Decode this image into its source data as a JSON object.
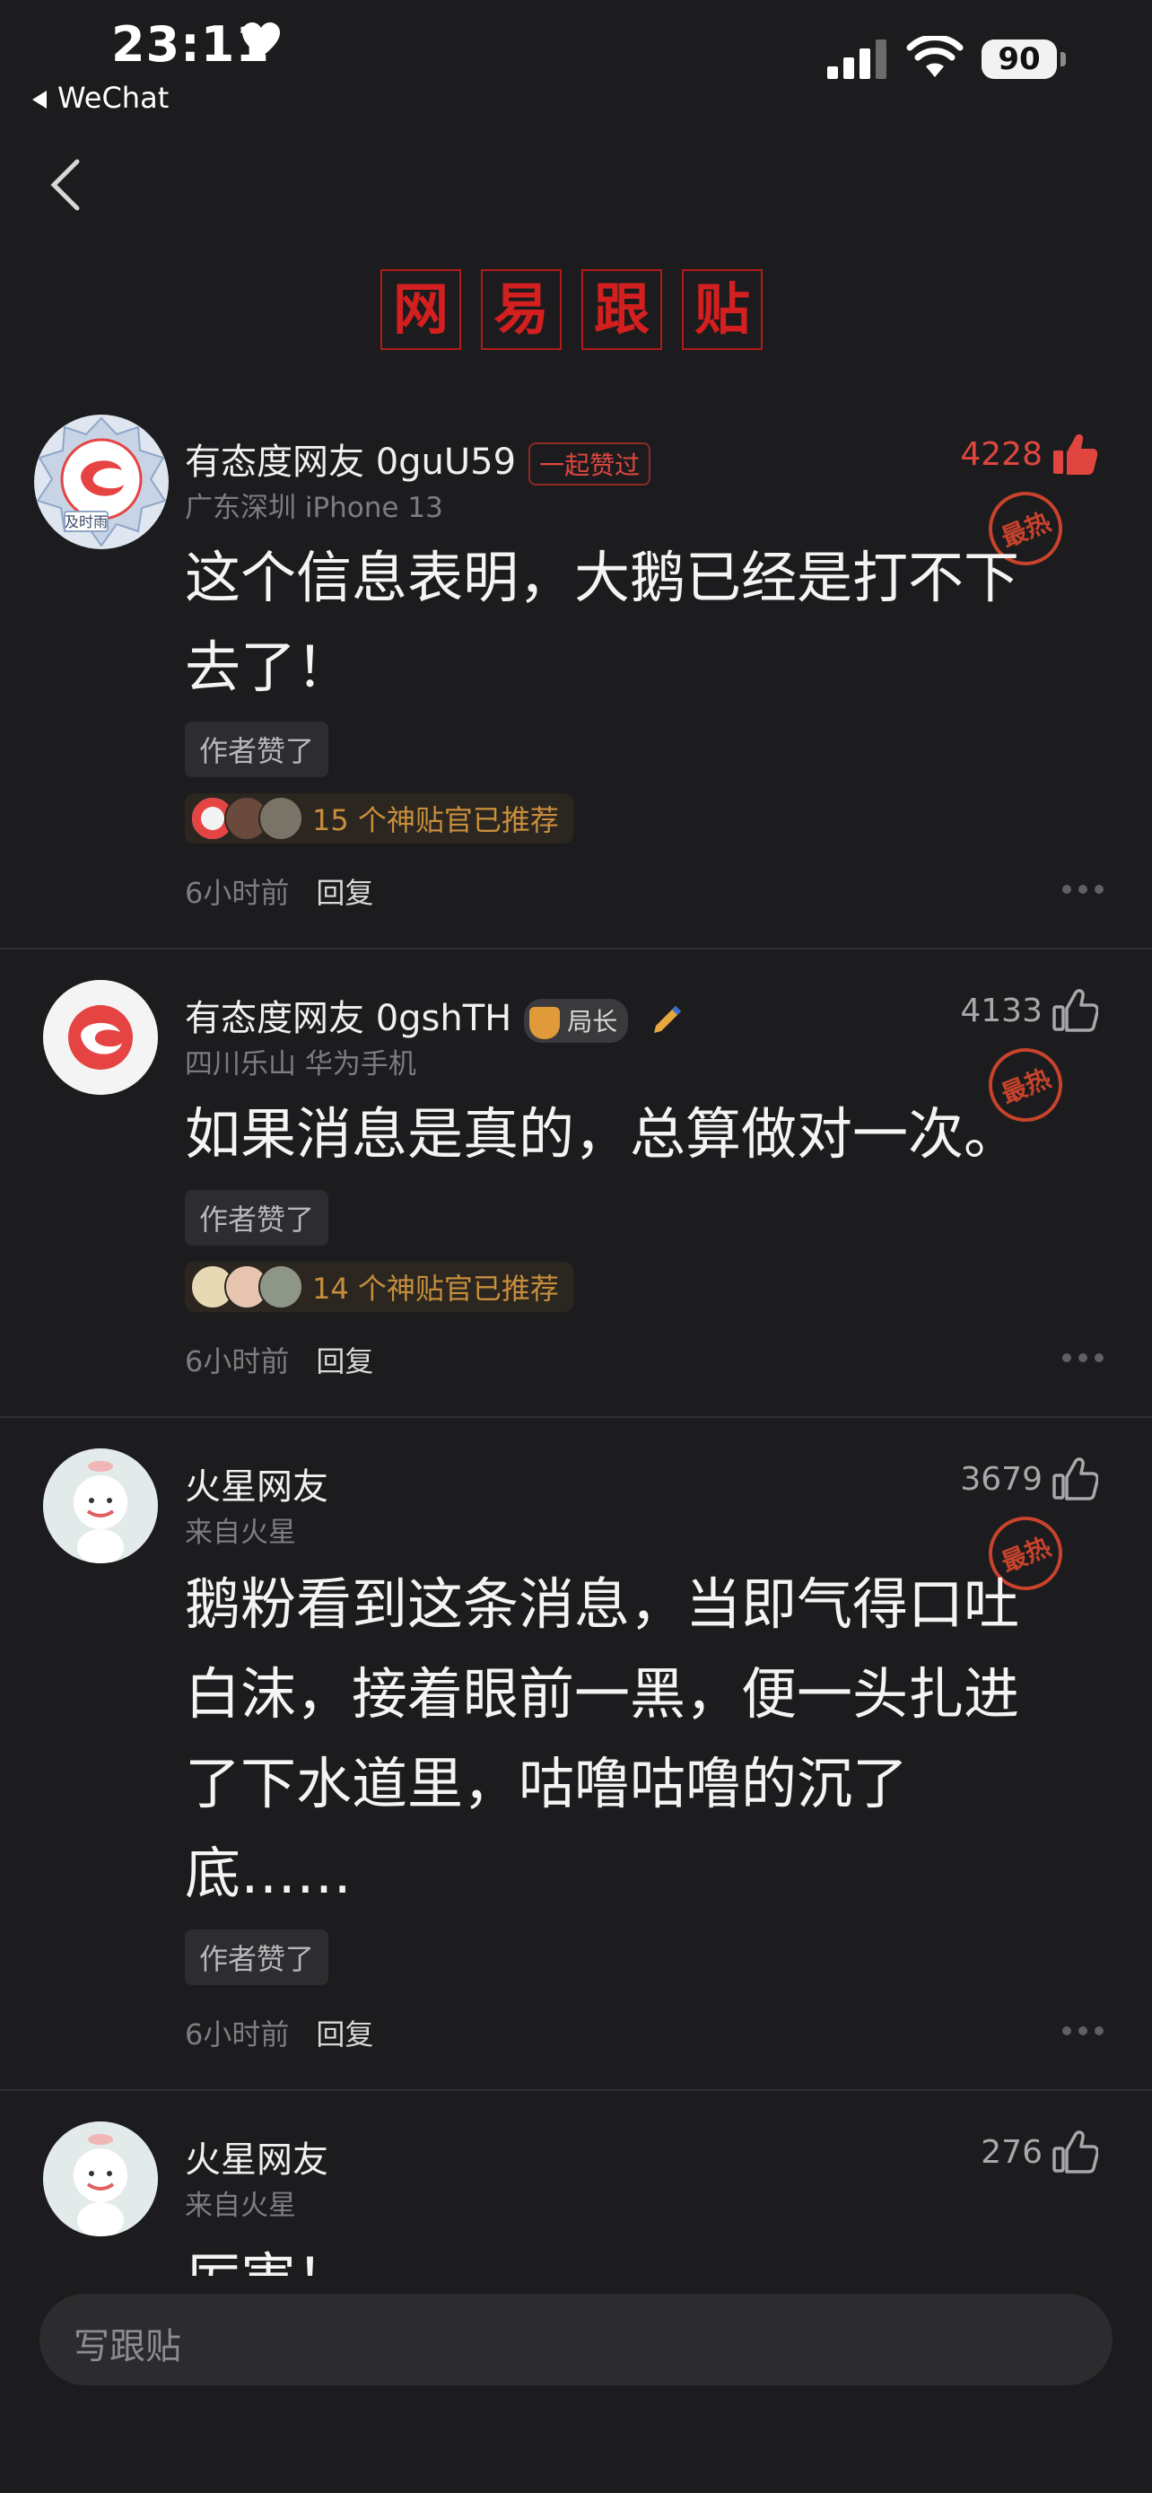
{
  "status_bar": {
    "time": "23:11",
    "back_app": "WeChat",
    "battery": "90"
  },
  "header": {
    "brand_chars": [
      "网",
      "易",
      "跟",
      "贴"
    ]
  },
  "comments": [
    {
      "username": "有态度网友 0guU59",
      "badge": "一起赞过",
      "meta": "广东深圳  iPhone 13",
      "likes": "4228",
      "hot": "最热",
      "text": "这个信息表明，大鹅已经是打不下去了！",
      "author_liked": "作者赞了",
      "recommend": "15 个神贴官已推荐",
      "time": "6小时前",
      "reply": "回复"
    },
    {
      "username": "有态度网友 0gshTH",
      "badge": "局长",
      "meta": "四川乐山  华为手机",
      "likes": "4133",
      "hot": "最热",
      "text": "如果消息是真的，总算做对一次。",
      "author_liked": "作者赞了",
      "recommend": "14 个神贴官已推荐",
      "time": "6小时前",
      "reply": "回复"
    },
    {
      "username": "火星网友",
      "meta": "来自火星",
      "likes": "3679",
      "hot": "最热",
      "text": "鹅粉看到这条消息，当即气得口吐白沫，接着眼前一黑，便一头扎进了下水道里，咕噜咕噜的沉了底……",
      "author_liked": "作者赞了",
      "time": "6小时前",
      "reply": "回复"
    },
    {
      "username": "火星网友",
      "meta": "来自火星",
      "likes": "276",
      "text": "厉害！"
    }
  ],
  "input": {
    "placeholder": "写跟贴"
  },
  "avatar_badge": "及时雨",
  "colors": {
    "background": "#1c1c1e",
    "accent_red": "#e0463f",
    "brand_red": "#d31f1f",
    "gold": "#c78e3c"
  },
  "icons": [
    "heart-icon",
    "signal-icon",
    "wifi-icon",
    "back-arrow-icon",
    "thumbs-up-icon",
    "more-icon"
  ]
}
